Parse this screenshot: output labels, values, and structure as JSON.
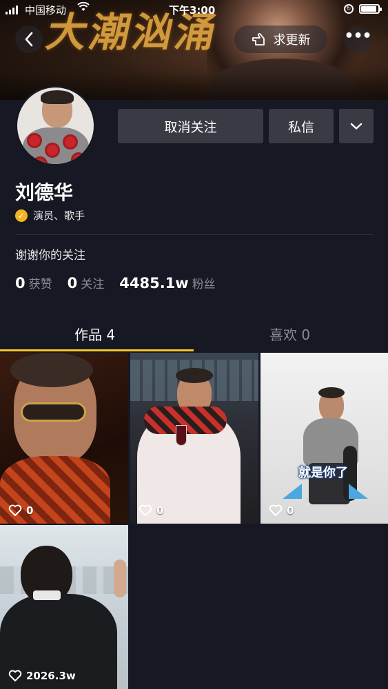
{
  "status_bar": {
    "carrier": "中国移动",
    "time": "下午3:00"
  },
  "banner": {
    "calligraphy": "大潮汹涌"
  },
  "top_nav": {
    "update_label": "求更新"
  },
  "profile": {
    "name": "刘德华",
    "verified_label": "演员、歌手",
    "bio": "谢谢你的关注",
    "stats": [
      {
        "value": "0",
        "label": "获赞"
      },
      {
        "value": "0",
        "label": "关注"
      },
      {
        "value": "4485.1w",
        "label": "粉丝"
      }
    ]
  },
  "actions": {
    "unfollow_label": "取消关注",
    "message_label": "私信"
  },
  "tabs": [
    {
      "label": "作品 4",
      "active": true
    },
    {
      "label": "喜欢 0",
      "active": false
    }
  ],
  "videos": [
    {
      "likes": "0"
    },
    {
      "likes": "0"
    },
    {
      "likes": "0",
      "caption": "就是你了"
    },
    {
      "likes": "2026.3w"
    }
  ],
  "colors": {
    "background": "#161823",
    "button": "#393b44",
    "accent": "#f8c821",
    "verified": "#f5b523"
  }
}
